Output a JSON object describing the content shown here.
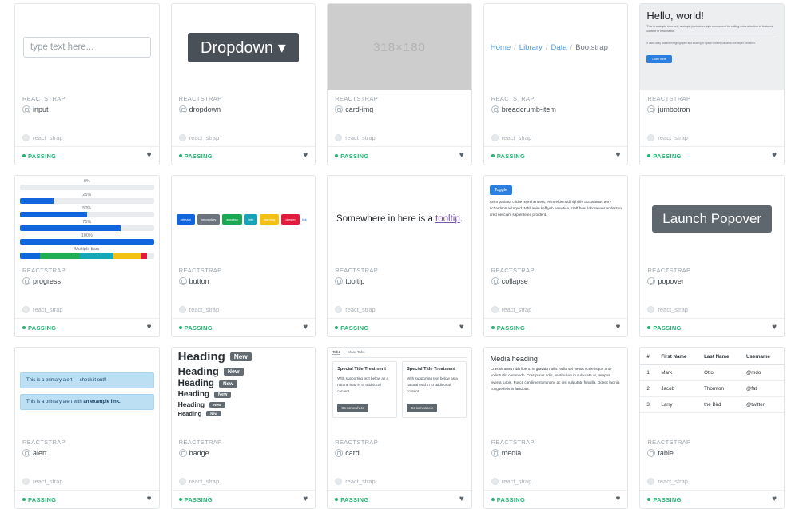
{
  "brand_label": "REACTSTRAP",
  "tag_label": "react_strap",
  "status_label": "PASSING",
  "colors": {
    "passing": "#22b573",
    "primary": "#1266dd",
    "link": "#2a7fe0",
    "dark": "#495057",
    "gray": "#5f676e",
    "badge": "#636c72",
    "alert_bg": "#bcdff4",
    "tooltip_link": "#7952b3"
  },
  "cards": [
    {
      "component": "input",
      "preview": {
        "kind": "input",
        "placeholder": "type text here..."
      }
    },
    {
      "component": "dropdown",
      "preview": {
        "kind": "dropdown",
        "label": "Dropdown",
        "caret": "▾"
      }
    },
    {
      "component": "card-img",
      "preview": {
        "kind": "image",
        "label": "318×180"
      }
    },
    {
      "component": "breadcrumb-item",
      "preview": {
        "kind": "breadcrumb",
        "items": [
          "Home",
          "Library",
          "Data",
          "Bootstrap"
        ],
        "separator": "/"
      }
    },
    {
      "component": "jumbotron",
      "preview": {
        "kind": "jumbotron",
        "heading": "Hello, world!",
        "lead": "This is a simple hero unit, a simple jumbotron-style component for calling extra attention to featured content or information.",
        "sub": "It uses utility classes for typography and spacing to space content out within the larger container.",
        "button": "Learn more"
      }
    },
    {
      "component": "progress",
      "preview": {
        "kind": "progress",
        "rows": [
          {
            "label": "0%",
            "value": 0
          },
          {
            "label": "25%",
            "value": 25
          },
          {
            "label": "50%",
            "value": 50
          },
          {
            "label": "75%",
            "value": 75
          },
          {
            "label": "100%",
            "value": 100
          }
        ],
        "multi_label": "Multiple bars",
        "multi": [
          {
            "value": 15,
            "color": "#1266dd"
          },
          {
            "value": 30,
            "color": "#21ad54"
          },
          {
            "value": 25,
            "color": "#17a8b8"
          },
          {
            "value": 20,
            "color": "#f3c114"
          },
          {
            "value": 5,
            "color": "#e21b3c"
          }
        ]
      }
    },
    {
      "component": "button",
      "preview": {
        "kind": "buttons",
        "buttons": [
          {
            "label": "primary",
            "color": "#1266dd"
          },
          {
            "label": "secondary",
            "color": "#6c757d"
          },
          {
            "label": "success",
            "color": "#1aa852"
          },
          {
            "label": "info",
            "color": "#18a2b8"
          },
          {
            "label": "warning",
            "color": "#f3c114"
          },
          {
            "label": "danger",
            "color": "#e21b3c"
          }
        ],
        "link_label": "link"
      }
    },
    {
      "component": "tooltip",
      "preview": {
        "kind": "tooltip",
        "before": "Somewhere in here is a ",
        "link": "tooltip",
        "after": "."
      }
    },
    {
      "component": "collapse",
      "preview": {
        "kind": "collapse",
        "button": "Toggle",
        "body": "Anim pariatur cliche reprehenderit, enim eiusmod high life accusamus terry richardson ad squid. Nihil anim keffiyeh helvetica, craft beer labore wes anderson cred nesciunt sapiente ea proident."
      }
    },
    {
      "component": "popover",
      "preview": {
        "kind": "popover",
        "button": "Launch Popover"
      }
    },
    {
      "component": "alert",
      "preview": {
        "kind": "alerts",
        "alerts": [
          {
            "text": "This is a primary alert — check it out!!",
            "bold": ""
          },
          {
            "text": "This is a primary alert with ",
            "bold": "an example link."
          }
        ]
      }
    },
    {
      "component": "badge",
      "preview": {
        "kind": "badges",
        "heading_label": "Heading",
        "badge_label": "New",
        "sizes": [
          15,
          13,
          11.5,
          10,
          8.5,
          7.5
        ]
      }
    },
    {
      "component": "card",
      "preview": {
        "kind": "cards",
        "tabs": [
          "Tab1",
          "Moar Tabs"
        ],
        "items": [
          {
            "title": "Special Title Treatment",
            "text": "With supporting text below as a natural lead in to additional content.",
            "button": "Go somewhere"
          },
          {
            "title": "Special Title Treatment",
            "text": "With supporting text below as a natural lead in to additional content.",
            "button": "Go somewhere"
          }
        ]
      }
    },
    {
      "component": "media",
      "preview": {
        "kind": "media",
        "heading": "Media heading",
        "body": "Cras sit amet nibh libero, in gravida nulla. Nulla vel metus scelerisque ante sollicitudin commodo. Cras purus odio, vestibulum in vulputate at, tempus viverra turpis. Fusce condimentum nunc ac nisi vulputate fringilla. Donec lacinia congue felis in faucibus."
      }
    },
    {
      "component": "table",
      "preview": {
        "kind": "table",
        "headers": [
          "#",
          "First Name",
          "Last Name",
          "Username"
        ],
        "rows": [
          [
            "1",
            "Mark",
            "Otto",
            "@mdo"
          ],
          [
            "2",
            "Jacob",
            "Thornton",
            "@fat"
          ],
          [
            "3",
            "Larry",
            "the Bird",
            "@twitter"
          ]
        ]
      }
    }
  ]
}
